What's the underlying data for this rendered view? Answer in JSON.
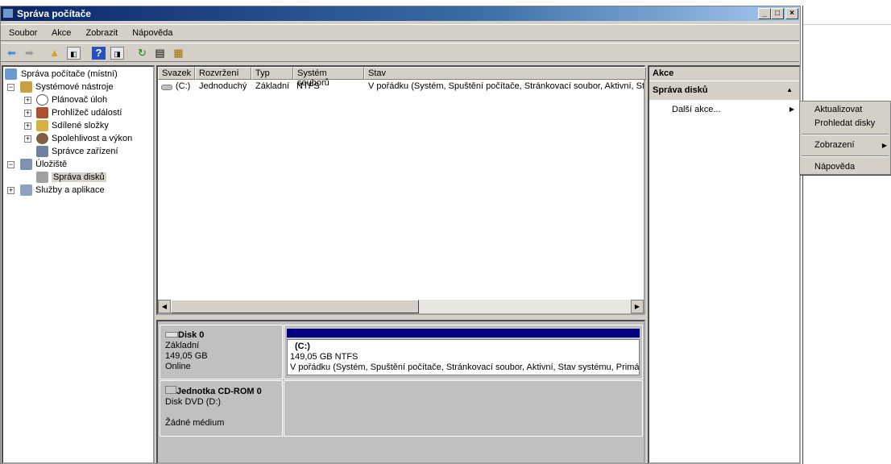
{
  "window": {
    "title": "Správa počítače"
  },
  "menu": [
    "Soubor",
    "Akce",
    "Zobrazit",
    "Nápověda"
  ],
  "tree": [
    {
      "label": "Správa počítače (místní)"
    },
    {
      "label": "Systémové nástroje"
    },
    {
      "label": "Plánovač úloh"
    },
    {
      "label": "Prohlížeč událostí"
    },
    {
      "label": "Sdílené složky"
    },
    {
      "label": "Spolehlivost a výkon"
    },
    {
      "label": "Správce zařízení"
    },
    {
      "label": "Úložiště"
    },
    {
      "label": "Správa disků"
    },
    {
      "label": "Služby a aplikace"
    }
  ],
  "list": {
    "columns": [
      "Svazek",
      "Rozvržení",
      "Typ",
      "Systém souborů",
      "Stav"
    ],
    "rows": [
      {
        "volume": "(C:)",
        "layout": "Jednoduchý",
        "type": "Základní",
        "fs": "NTFS",
        "status": "V pořádku (Systém, Spuštění počítače, Stránkovací soubor, Aktivní, Stav systému, Primární oddíl)"
      }
    ]
  },
  "disks": [
    {
      "name": "Disk 0",
      "type": "Základní",
      "size": "149,05 GB",
      "state": "Online",
      "partition": {
        "label": "(C:)",
        "size": "149,05 GB NTFS",
        "status": "V pořádku (Systém, Spuštění počítače, Stránkovací soubor, Aktivní, Stav systému, Primár"
      }
    },
    {
      "name": "Jednotka CD-ROM 0",
      "type": "Disk DVD (D:)",
      "state": "Žádné médium"
    }
  ],
  "actions": {
    "header": "Akce",
    "section": "Správa disků",
    "more": "Další akce..."
  },
  "context_menu": [
    "Aktualizovat",
    "Prohledat disky",
    "Zobrazení",
    "Nápověda"
  ],
  "colors": {
    "titlebar": "#0a246a",
    "partition_bar": "#000080"
  }
}
